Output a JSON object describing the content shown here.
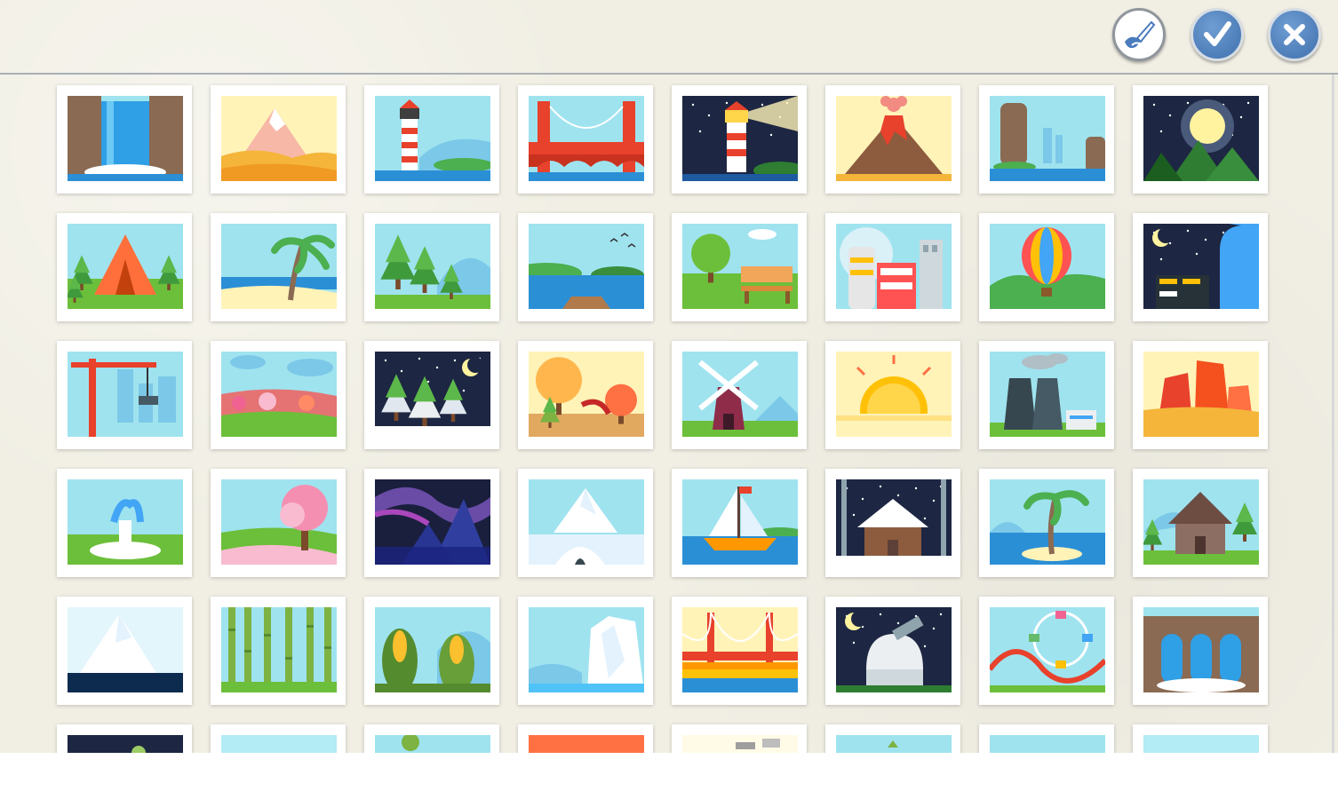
{
  "toolbar": {
    "buttons": [
      {
        "id": "paint",
        "icon": "paintbrush-icon"
      },
      {
        "id": "confirm",
        "icon": "checkmark-icon"
      },
      {
        "id": "close",
        "icon": "close-icon"
      }
    ]
  },
  "colors": {
    "background": "#f1efe4",
    "button_blue": "#4a7bbd",
    "divider": "#a9b0b5"
  },
  "scenes": [
    "waterfall-icon",
    "desert-dunes-icon",
    "lighthouse-icon",
    "red-bridge-icon",
    "lighthouse-night-icon",
    "volcano-icon",
    "rock-cliffs-icon",
    "moon-night-icon",
    "camping-tent-icon",
    "palm-beach-icon",
    "pine-forest-icon",
    "lake-pier-icon",
    "park-bench-icon",
    "city-buildings-icon",
    "hot-air-balloon-icon",
    "night-city-icon",
    "crane-city-icon",
    "flower-field-icon",
    "snowy-forest-icon",
    "autumn-trees-icon",
    "windmill-icon",
    "sunrise-icon",
    "factory-icon",
    "red-canyon-icon",
    "fountain-icon",
    "cherry-blossom-icon",
    "aurora-icon",
    "igloo-icon",
    "sailboat-icon",
    "winter-cabin-icon",
    "palm-island-icon",
    "forest-cabin-icon",
    "iceberg-icon",
    "bamboo-forest-icon",
    "corn-field-icon",
    "glacier-icon",
    "golden-gate-bridge-icon",
    "observatory-icon",
    "amusement-park-icon",
    "ancient-gate-icon",
    "night-garden-icon",
    "seaside-icon",
    "hillside-icon",
    "orange-wall-icon",
    "train-station-icon",
    "green-hill-icon",
    "sky-icon",
    "meadow-icon"
  ]
}
